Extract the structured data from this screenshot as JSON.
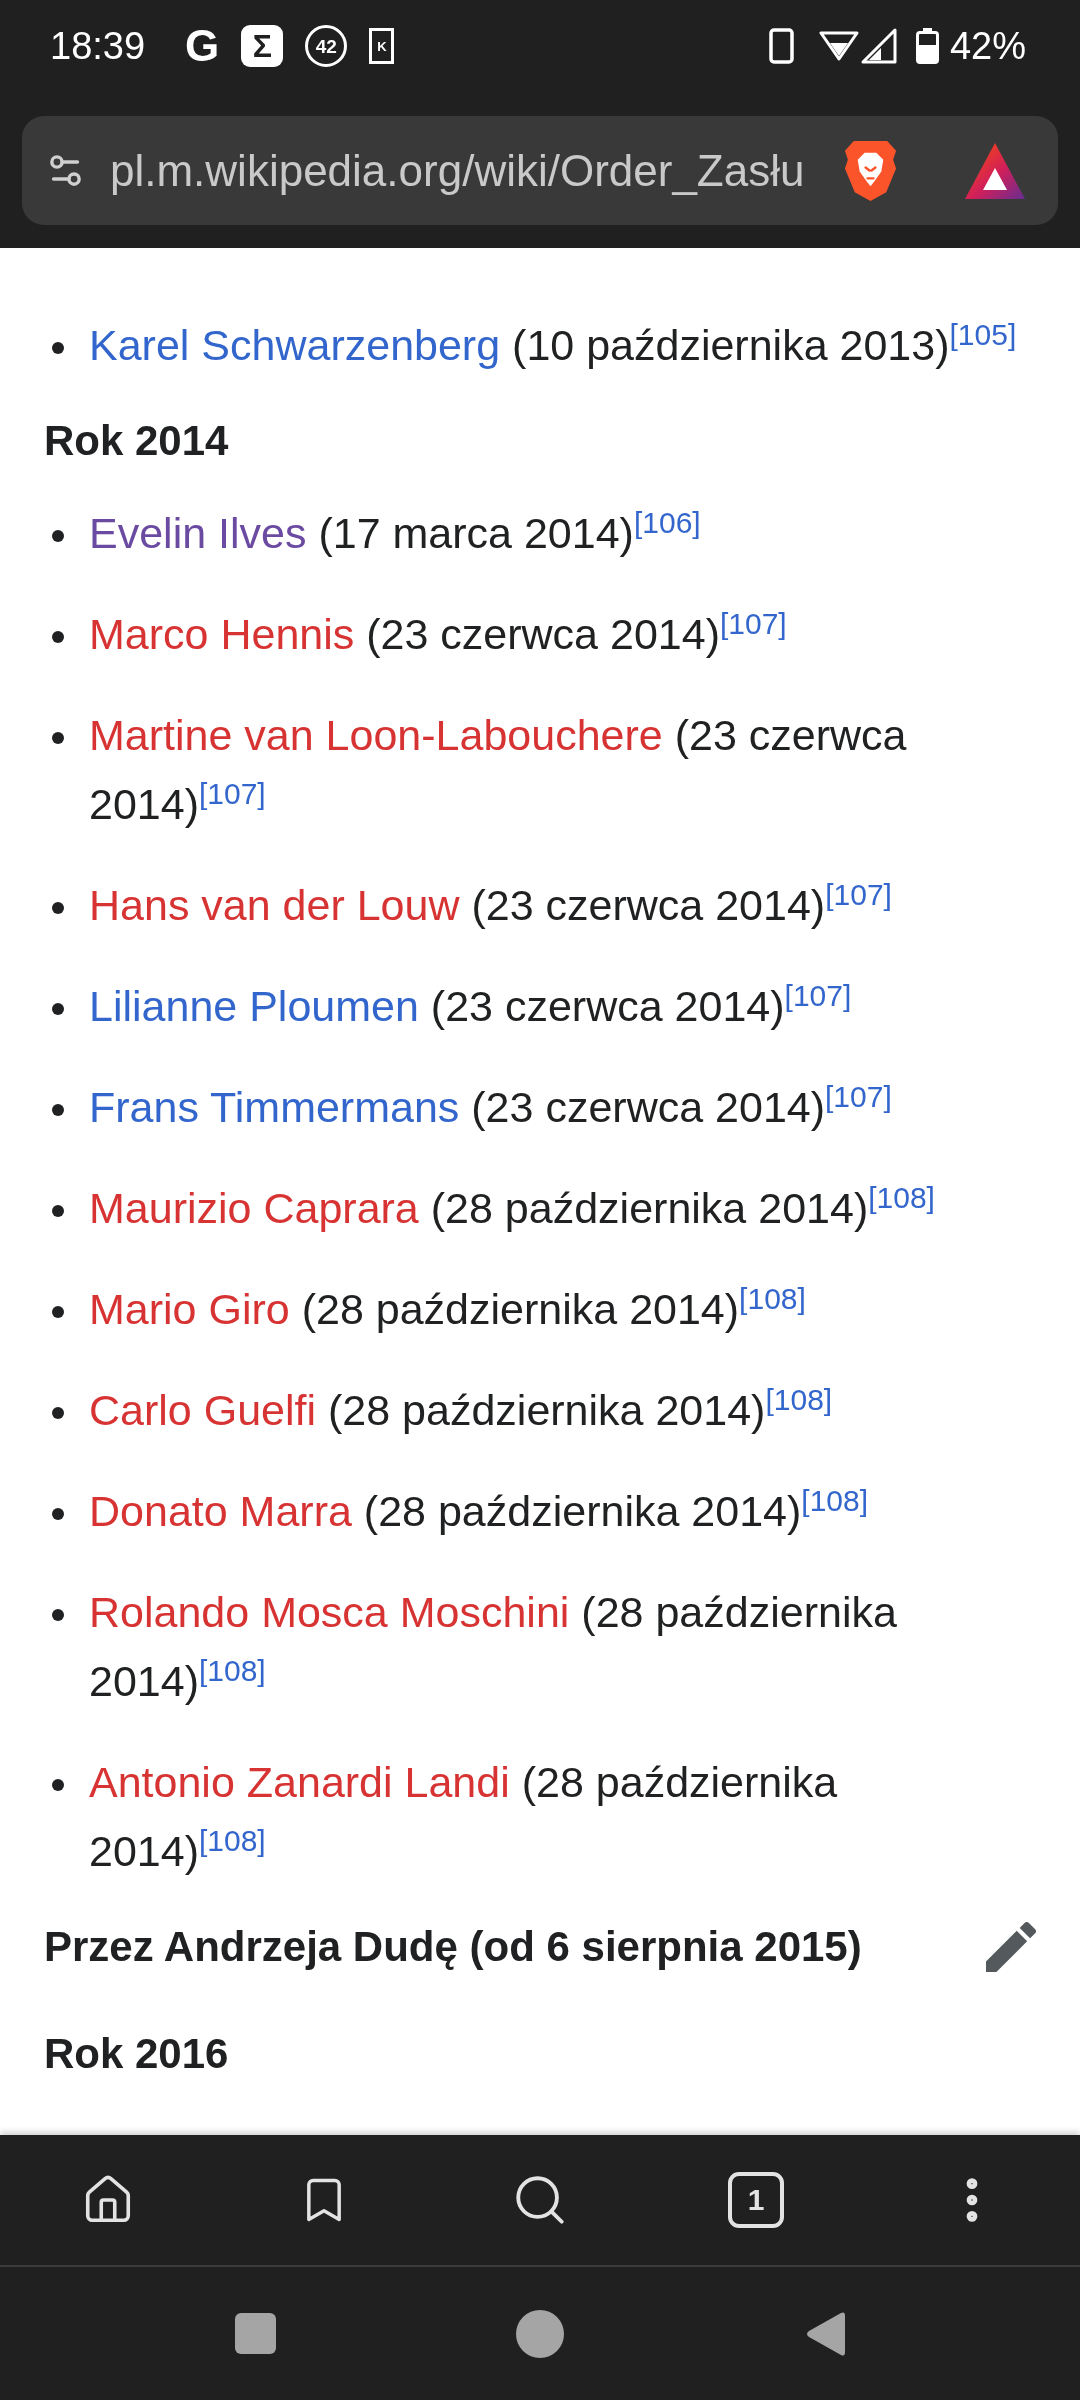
{
  "status_bar": {
    "time": "18:39",
    "notifications": [
      {
        "kind": "letter",
        "text": "G"
      },
      {
        "kind": "tile",
        "text": "Σ"
      },
      {
        "kind": "ring",
        "text": "42"
      },
      {
        "kind": "card",
        "text": "K"
      }
    ],
    "battery_percent": "42%"
  },
  "address_bar": {
    "url": "pl.m.wikipedia.org/wiki/Order_Zasłu"
  },
  "article": {
    "blocks": [
      {
        "kind": "item",
        "name": "Karel Schwarzenberg",
        "exists": true,
        "visited": false,
        "date": "(10 października 2013)",
        "ref": "[105]"
      },
      {
        "kind": "subheading",
        "text": "Rok 2014"
      },
      {
        "kind": "item",
        "name": "Evelin Ilves",
        "exists": true,
        "visited": true,
        "date": "(17 marca 2014)",
        "ref": "[106]"
      },
      {
        "kind": "item",
        "name": "Marco Hennis",
        "exists": false,
        "visited": false,
        "date": "(23 czerwca 2014)",
        "ref": "[107]"
      },
      {
        "kind": "item",
        "name": "Martine van Loon-Labouchere",
        "exists": false,
        "visited": false,
        "date": "(23 czerwca 2014)",
        "ref": "[107]"
      },
      {
        "kind": "item",
        "name": "Hans van der Louw",
        "exists": false,
        "visited": false,
        "date": "(23 czerwca 2014)",
        "ref": "[107]"
      },
      {
        "kind": "item",
        "name": "Lilianne Ploumen",
        "exists": true,
        "visited": false,
        "date": "(23 czerwca 2014)",
        "ref": "[107]"
      },
      {
        "kind": "item",
        "name": "Frans Timmermans",
        "exists": true,
        "visited": false,
        "date": "(23 czerwca 2014)",
        "ref": "[107]"
      },
      {
        "kind": "item",
        "name": "Maurizio Caprara",
        "exists": false,
        "visited": false,
        "date": "(28 października 2014)",
        "ref": "[108]"
      },
      {
        "kind": "item",
        "name": "Mario Giro",
        "exists": false,
        "visited": false,
        "date": "(28 października 2014)",
        "ref": "[108]"
      },
      {
        "kind": "item",
        "name": "Carlo Guelfi",
        "exists": false,
        "visited": false,
        "date": "(28 października 2014)",
        "ref": "[108]"
      },
      {
        "kind": "item",
        "name": "Donato Marra",
        "exists": false,
        "visited": false,
        "date": "(28 października 2014)",
        "ref": "[108]"
      },
      {
        "kind": "item",
        "name": "Rolando Mosca Moschini",
        "exists": false,
        "visited": false,
        "date": "(28 października 2014)",
        "ref": "[108]"
      },
      {
        "kind": "item",
        "name": "Antonio Zanardi Landi",
        "exists": false,
        "visited": false,
        "date": "(28 października 2014)",
        "ref": "[108]"
      },
      {
        "kind": "section_heading",
        "text": "Przez Andrzeja Dudę (od 6 sierpnia 2015)"
      },
      {
        "kind": "subheading",
        "text": "Rok 2016"
      }
    ]
  },
  "toolbar": {
    "tab_count": "1"
  }
}
